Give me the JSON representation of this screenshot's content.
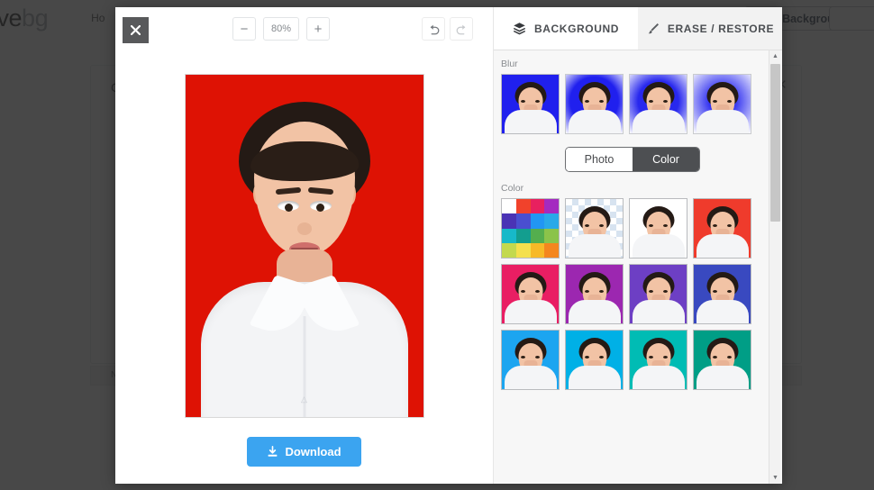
{
  "background_page": {
    "logo_primary": "ove",
    "logo_secondary": "bg",
    "nav_item": "Ho",
    "cta_label": "ove Background",
    "panel_label": "C",
    "panel_close": "×",
    "footer_label": "N"
  },
  "editor": {
    "close_label": "✖",
    "zoom": {
      "minus_label": "−",
      "level": "80%",
      "plus_label": "+"
    },
    "history": {
      "undo_name": "undo-icon",
      "redo_name": "redo-icon"
    },
    "canvas": {
      "background_color": "#DE1204",
      "watermark": "△"
    },
    "download_label": "Download",
    "download_color": "#3ba4f0"
  },
  "sidebar": {
    "tabs": [
      {
        "label": "BACKGROUND",
        "icon": "layers-icon",
        "active": true
      },
      {
        "label": "ERASE / RESTORE",
        "icon": "brush-icon",
        "active": false
      }
    ],
    "blur": {
      "label": "Blur",
      "items": [
        {
          "name": "blur-none",
          "color": "#2020ee",
          "blur": 0,
          "selected": false
        },
        {
          "name": "blur-light",
          "color": "#2020ee",
          "blur": 2,
          "selected": true
        },
        {
          "name": "blur-medium",
          "color": "#2828ee",
          "blur": 5,
          "selected": true
        },
        {
          "name": "blur-heavy",
          "color": "#3030f0",
          "blur": 11,
          "selected": true
        }
      ]
    },
    "source_toggle": {
      "options": [
        "Photo",
        "Color"
      ],
      "selected": "Color"
    },
    "color": {
      "label": "Color",
      "palette_swatches": [
        "#ffffff",
        "#f1422b",
        "#e8205f",
        "#a42ac0",
        "#4a33b5",
        "#4a4fd0",
        "#2196f3",
        "#29a9e8",
        "#17b9c9",
        "#139e8f",
        "#54ae4e",
        "#8bc34a",
        "#c3d94e",
        "#f4e04d",
        "#f7b927",
        "#f4861f"
      ],
      "items": [
        {
          "name": "transparent-background",
          "type": "checker"
        },
        {
          "name": "white-background",
          "color": "#ffffff"
        },
        {
          "name": "red-background",
          "color": "#ef3b2c"
        },
        {
          "name": "pink-background",
          "color": "#e91e63"
        },
        {
          "name": "purple-background",
          "color": "#9c27b0"
        },
        {
          "name": "deep-purple-background",
          "color": "#6d3fc4"
        },
        {
          "name": "indigo-background",
          "color": "#3949c0"
        },
        {
          "name": "blue-background",
          "color": "#1ca5f0"
        },
        {
          "name": "light-blue-background",
          "color": "#00b0e6"
        },
        {
          "name": "cyan-background",
          "color": "#00bcb4"
        },
        {
          "name": "teal-background",
          "color": "#009e86"
        }
      ]
    },
    "scrollbar": {
      "up_label": "▲",
      "down_label": "▼"
    }
  }
}
